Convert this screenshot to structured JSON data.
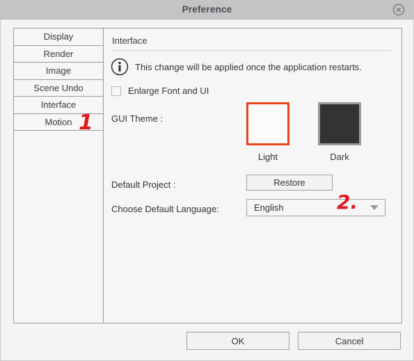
{
  "window": {
    "title": "Preference",
    "close_icon": "close-circle-icon"
  },
  "sidebar": {
    "items": [
      {
        "label": "Display"
      },
      {
        "label": "Render"
      },
      {
        "label": "Image"
      },
      {
        "label": "Scene Undo"
      },
      {
        "label": "Interface"
      },
      {
        "label": "Motion"
      }
    ]
  },
  "panel": {
    "title": "Interface",
    "info": {
      "icon": "info-circle-icon",
      "message": "This change will be applied once the application restarts."
    },
    "enlarge_font": {
      "label": "Enlarge Font and UI",
      "checked": false
    },
    "gui_theme": {
      "label": "GUI Theme :",
      "selected": "Light",
      "options": [
        {
          "caption": "Light",
          "swatch_color": "#fbfbfb",
          "border_color": "#e8441a"
        },
        {
          "caption": "Dark",
          "swatch_color": "#333333",
          "border_color": "#9a9a9a"
        }
      ]
    },
    "default_project": {
      "label": "Default Project :",
      "button_label": "Restore"
    },
    "language": {
      "label": "Choose Default Language:",
      "value": "English",
      "arrow_icon": "chevron-down-icon"
    }
  },
  "footer": {
    "ok_label": "OK",
    "cancel_label": "Cancel"
  },
  "annotations": [
    {
      "text": "1",
      "color": "#e01b1b"
    },
    {
      "text": "2.",
      "color": "#e01b1b"
    }
  ]
}
